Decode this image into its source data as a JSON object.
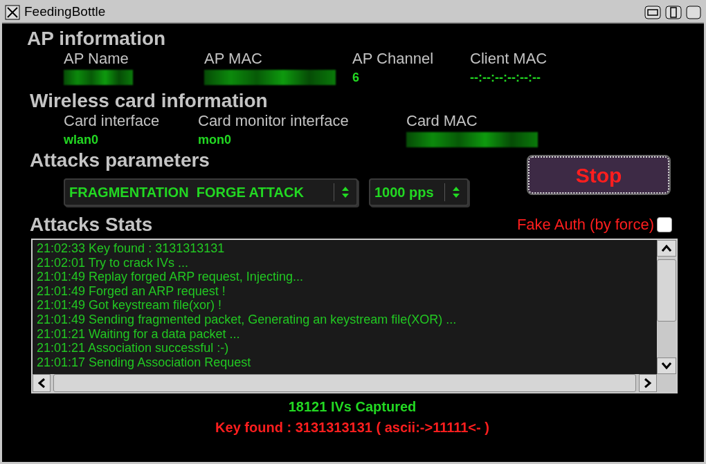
{
  "window": {
    "title": "FeedingBottle"
  },
  "ap_information": {
    "title": "AP information",
    "columns": [
      {
        "label": "AP Name",
        "kind": "redacted"
      },
      {
        "label": "AP MAC",
        "kind": "redacted"
      },
      {
        "label": "AP Channel",
        "kind": "text",
        "value": "6"
      },
      {
        "label": "Client MAC",
        "kind": "text",
        "value": "--:--:--:--:--:--"
      }
    ]
  },
  "wireless_card_information": {
    "title": "Wireless card information",
    "columns": [
      {
        "label": "Card interface",
        "kind": "text",
        "value": "wlan0"
      },
      {
        "label": "Card monitor interface",
        "kind": "text",
        "value": "mon0"
      },
      {
        "label": "Card MAC",
        "kind": "redacted"
      }
    ]
  },
  "attacks_parameters": {
    "title": "Attacks parameters",
    "attack_select": {
      "value": "FRAGMENTATION  FORGE ATTACK"
    },
    "rate_select": {
      "value": "1000 pps"
    },
    "stop_button": "Stop"
  },
  "attacks_stats": {
    "title": "Attacks Stats",
    "fake_auth": {
      "label": "Fake Auth (by force)",
      "checked": false
    },
    "log": [
      "21:02:33 Key found : 3131313131",
      "21:02:01 Try to crack IVs ...",
      "21:01:49 Replay forged ARP request, Injecting...",
      "21:01:49 Forged an ARP request !",
      "21:01:49 Got keystream file(xor) !",
      "21:01:49 Sending fragmented packet, Generating an keystream file(XOR) ...",
      "21:01:21 Waiting for a data packet ...",
      "21:01:21 Association successful :-)",
      "21:01:17 Sending Association Request"
    ]
  },
  "ivs_captured": "18121 IVs Captured",
  "key_found": "Key found : 3131313131 ( ascii:->11111<- )"
}
